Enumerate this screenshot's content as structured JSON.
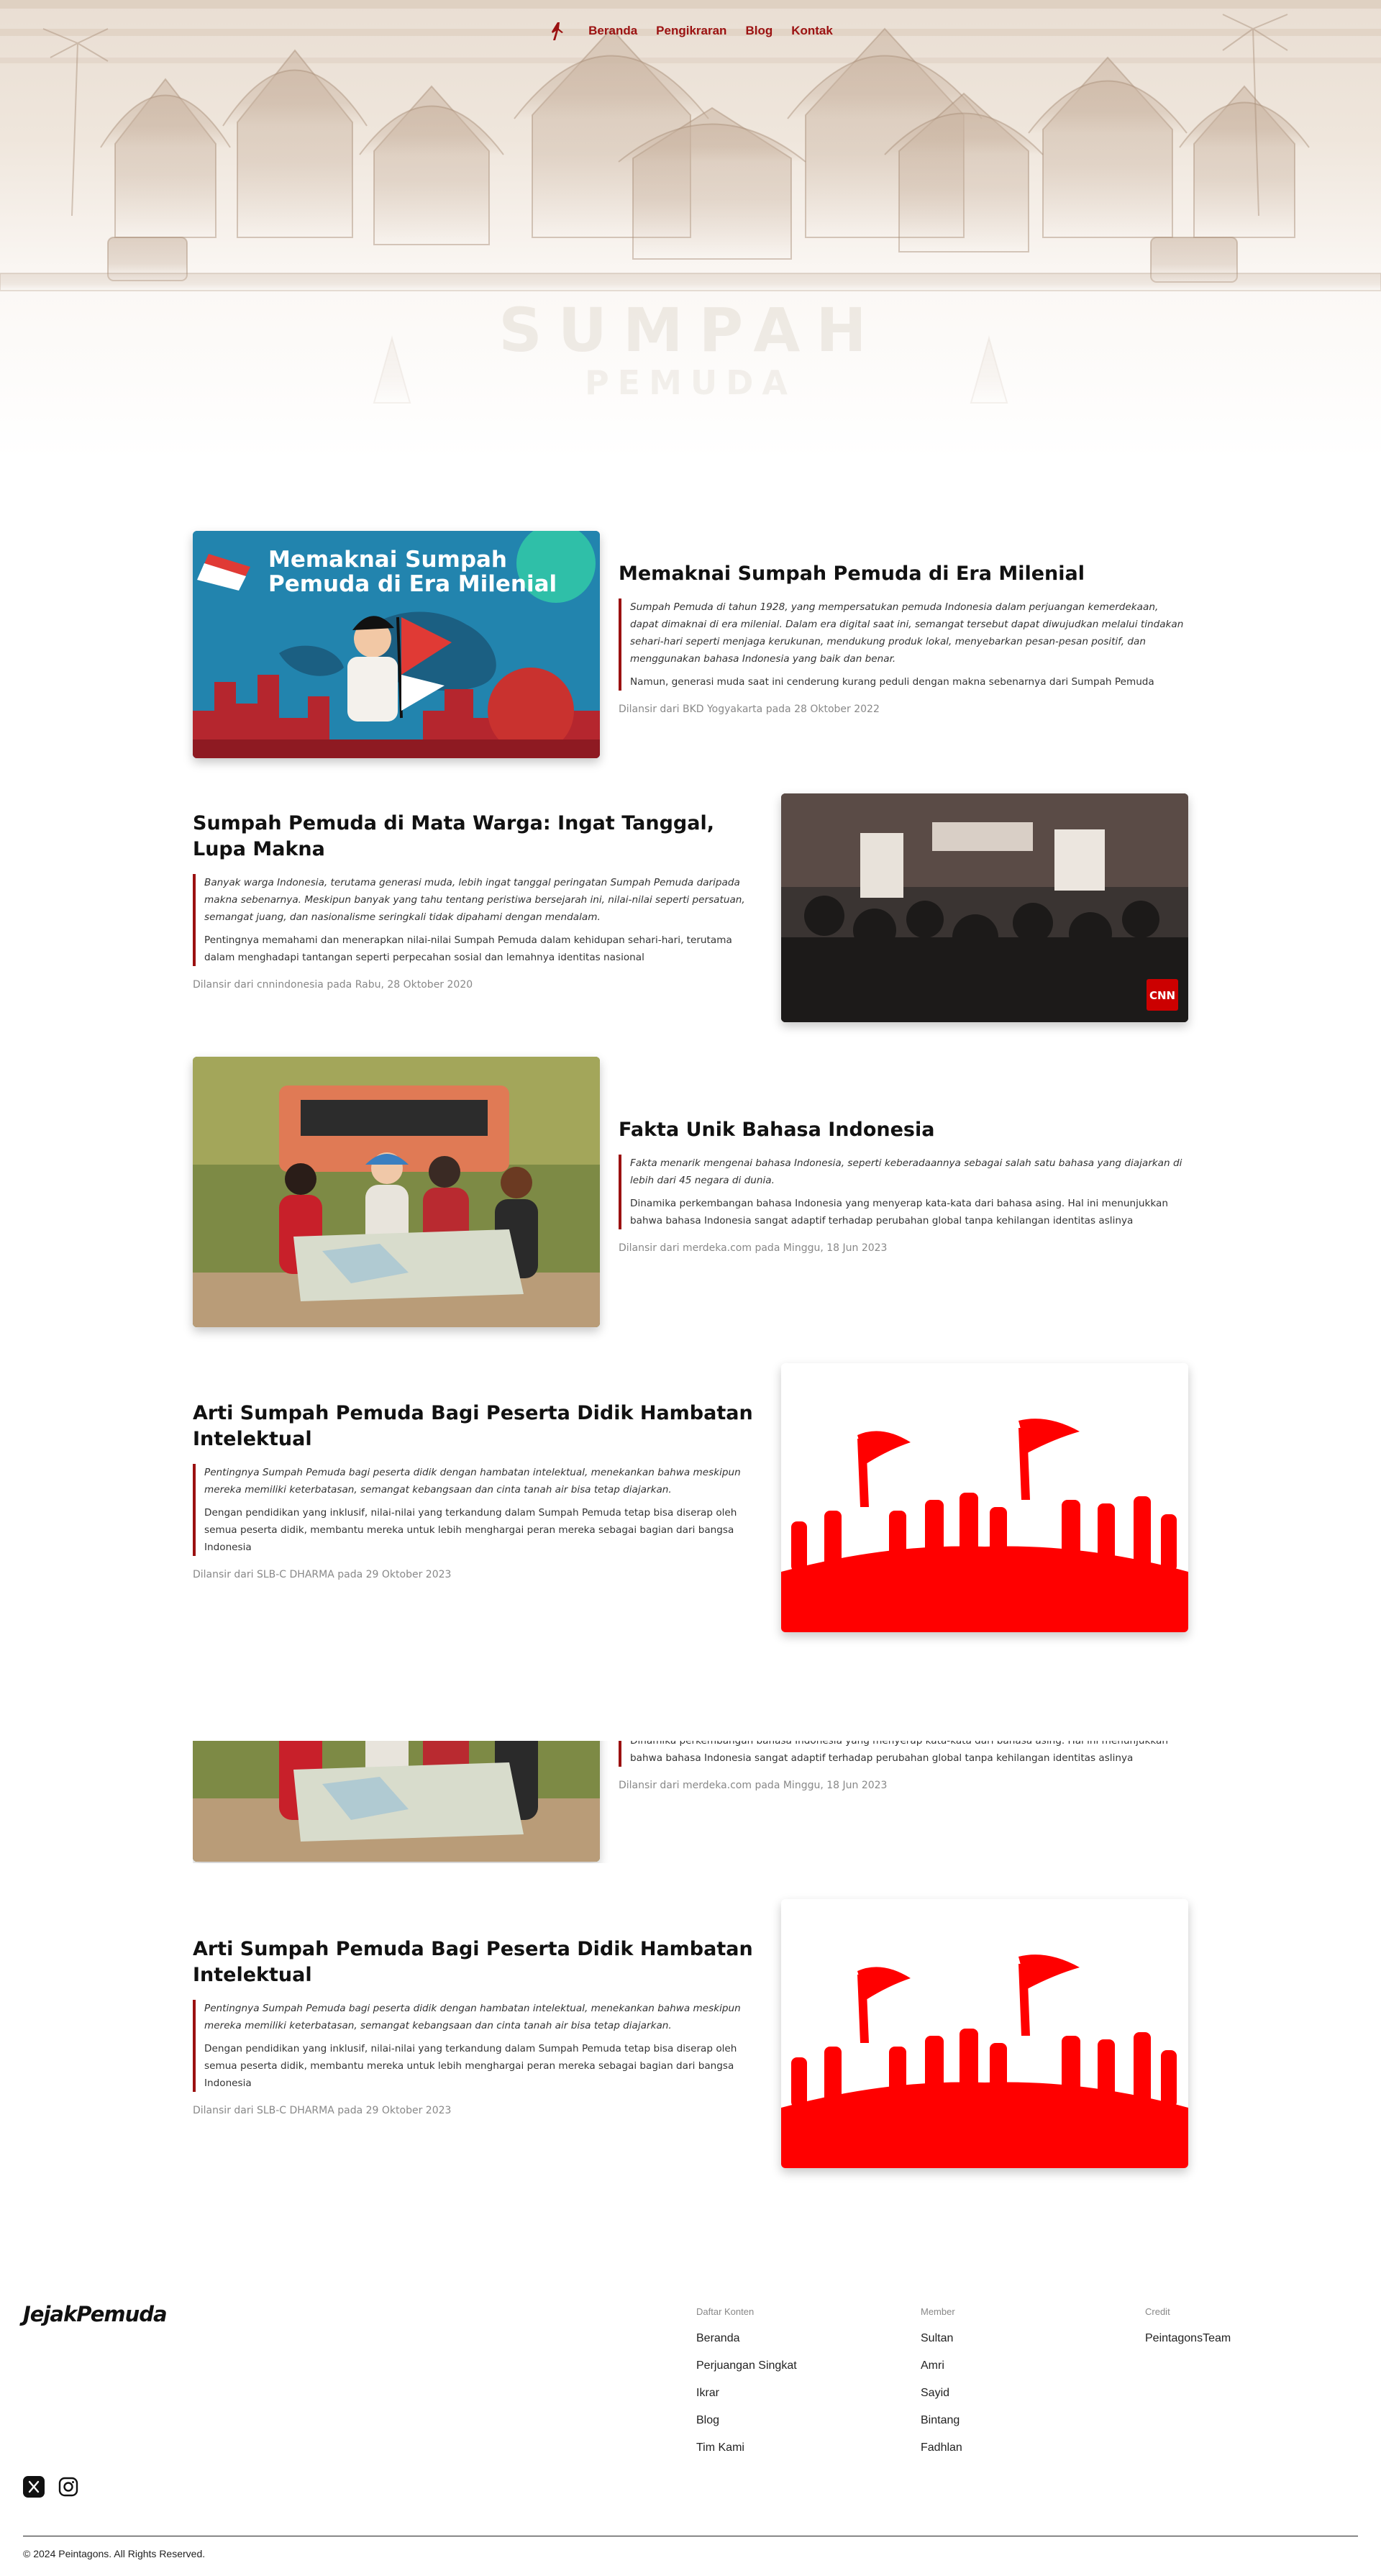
{
  "nav": {
    "items": [
      "Beranda",
      "Pengikraran",
      "Blog",
      "Kontak"
    ]
  },
  "hero": {
    "title": "SUMPAH",
    "subtitle": "PEMUDA"
  },
  "articles": [
    {
      "title": "Memaknai Sumpah Pemuda di Era Milenial",
      "lead": "Sumpah Pemuda di tahun 1928, yang mempersatukan pemuda Indonesia dalam perjuangan kemerdekaan, dapat dimaknai di era milenial. Dalam era digital saat ini, semangat tersebut dapat diwujudkan melalui tindakan sehari-hari seperti menjaga kerukunan, mendukung produk lokal, menyebarkan pesan-pesan positif, dan menggunakan bahasa Indonesia yang baik dan benar.",
      "body": "Namun, generasi muda saat ini cenderung kurang peduli dengan makna sebenarnya dari Sumpah Pemuda",
      "source": "Dilansir dari BKD Yogyakarta pada 28 Oktober 2022",
      "image_text": "Memaknai Sumpah Pemuda di Era Milenial"
    },
    {
      "title": "Sumpah Pemuda di Mata Warga: Ingat Tanggal, Lupa Makna",
      "lead": "Banyak warga Indonesia, terutama generasi muda, lebih ingat tanggal peringatan Sumpah Pemuda daripada makna sebenarnya. Meskipun banyak yang tahu tentang peristiwa bersejarah ini, nilai-nilai seperti persatuan, semangat juang, dan nasionalisme seringkali tidak dipahami dengan mendalam.",
      "body": "Pentingnya memahami dan menerapkan nilai-nilai Sumpah Pemuda dalam kehidupan sehari-hari, terutama dalam menghadapi tantangan seperti perpecahan sosial dan lemahnya identitas nasional",
      "source": "Dilansir dari cnnindonesia pada Rabu, 28 Oktober 2020",
      "image_text": "CNN"
    },
    {
      "title": "Fakta Unik Bahasa Indonesia",
      "lead": "Fakta menarik mengenai bahasa Indonesia, seperti keberadaannya sebagai salah satu bahasa yang diajarkan di lebih dari 45 negara di dunia.",
      "body": "Dinamika perkembangan bahasa Indonesia yang menyerap kata-kata dari bahasa asing. Hal ini menunjukkan bahwa bahasa Indonesia sangat adaptif terhadap perubahan global tanpa kehilangan identitas aslinya",
      "source": "Dilansir dari merdeka.com pada Minggu, 18 Jun 2023"
    },
    {
      "title": "Arti Sumpah Pemuda Bagi Peserta Didik Hambatan Intelektual",
      "lead": "Pentingnya Sumpah Pemuda bagi peserta didik dengan hambatan intelektual, menekankan bahwa meskipun mereka memiliki keterbatasan, semangat kebangsaan dan cinta tanah air bisa tetap diajarkan.",
      "body": "Dengan pendidikan yang inklusif, nilai-nilai yang terkandung dalam Sumpah Pemuda tetap bisa diserap oleh semua peserta didik, membantu mereka untuk lebih menghargai peran mereka sebagai bagian dari bangsa Indonesia",
      "source": "Dilansir dari SLB-C DHARMA pada 29 Oktober 2023"
    }
  ],
  "repeat": {
    "partial_body": "Dinamika perkembangan bahasa Indonesia yang menyerap kata-kata dari bahasa asing. Hal ini menunjukkan bahwa bahasa Indonesia sangat adaptif terhadap perubahan global tanpa kehilangan identitas aslinya",
    "partial_source": "Dilansir dari merdeka.com pada Minggu, 18 Jun 2023",
    "title": "Arti Sumpah Pemuda Bagi Peserta Didik Hambatan Intelektual",
    "lead": "Pentingnya Sumpah Pemuda bagi peserta didik dengan hambatan intelektual, menekankan bahwa meskipun mereka memiliki keterbatasan, semangat kebangsaan dan cinta tanah air bisa tetap diajarkan.",
    "body": "Dengan pendidikan yang inklusif, nilai-nilai yang terkandung dalam Sumpah Pemuda tetap bisa diserap oleh semua peserta didik, membantu mereka untuk lebih menghargai peran mereka sebagai bagian dari bangsa Indonesia",
    "source": "Dilansir dari SLB-C DHARMA pada 29 Oktober 2023"
  },
  "footer": {
    "logo": "JejakPemuda",
    "columns": [
      {
        "heading": "Daftar Konten",
        "items": [
          "Beranda",
          "Perjuangan Singkat",
          "Ikrar",
          "Blog",
          "Tim Kami"
        ]
      },
      {
        "heading": "Member",
        "items": [
          "Sultan",
          "Amri",
          "Sayid",
          "Bintang",
          "Fadhlan"
        ]
      },
      {
        "heading": "Credit",
        "items": [
          "PeintagonsTeam"
        ]
      }
    ],
    "social": [
      "x-icon",
      "instagram-icon"
    ],
    "copyright": "© 2024 Peintagons. All Rights Reserved."
  },
  "colors": {
    "accent": "#9b1111",
    "flag_red": "#ff0000",
    "hero_tint": "#e9ded3"
  }
}
